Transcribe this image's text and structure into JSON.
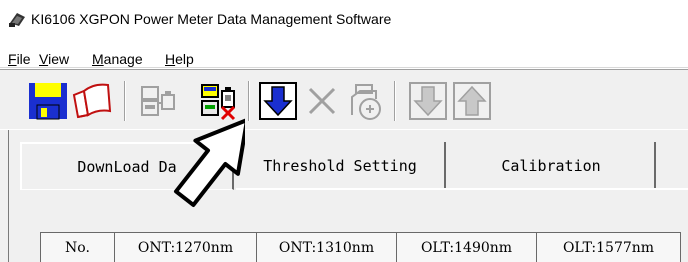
{
  "window": {
    "title": "KI6106 XGPON Power Meter Data Management Software",
    "icon": "app-meter-icon"
  },
  "menu": {
    "items": [
      {
        "label_acc": "F",
        "label_rest": "ile"
      },
      {
        "label_acc": "V",
        "label_rest": "iew"
      },
      {
        "label_acc": "M",
        "label_rest": "anage"
      },
      {
        "label_acc": "H",
        "label_rest": "elp"
      }
    ]
  },
  "toolbar": {
    "buttons": [
      {
        "name": "save",
        "icon": "floppy-disk-icon",
        "enabled": true
      },
      {
        "name": "open",
        "icon": "open-folder-icon",
        "enabled": true
      },
      {
        "name": "connect",
        "icon": "connect-device-icon",
        "enabled": false
      },
      {
        "name": "disconnect",
        "icon": "disconnect-device-icon",
        "enabled": true
      },
      {
        "name": "download",
        "icon": "download-arrow-icon",
        "enabled": true
      },
      {
        "name": "delete",
        "icon": "delete-x-icon",
        "enabled": false
      },
      {
        "name": "clear",
        "icon": "clear-data-icon",
        "enabled": false
      },
      {
        "name": "move-down",
        "icon": "arrow-down-icon",
        "enabled": false
      },
      {
        "name": "move-up",
        "icon": "arrow-up-icon",
        "enabled": false
      }
    ]
  },
  "tabs": [
    {
      "label": "DownLoad Da",
      "active": true
    },
    {
      "label": "Threshold Setting",
      "active": false
    },
    {
      "label": "Calibration",
      "active": false
    }
  ],
  "grid": {
    "columns": [
      "No.",
      "ONT:1270nm",
      "ONT:1310nm",
      "OLT:1490nm",
      "OLT:1577nm"
    ]
  },
  "colors": {
    "accent_blue": "#1a2fd0",
    "disabled_gray": "#a0a0a0",
    "toolbar_bg": "#f0f0f0",
    "delete_red": "#e00000"
  }
}
